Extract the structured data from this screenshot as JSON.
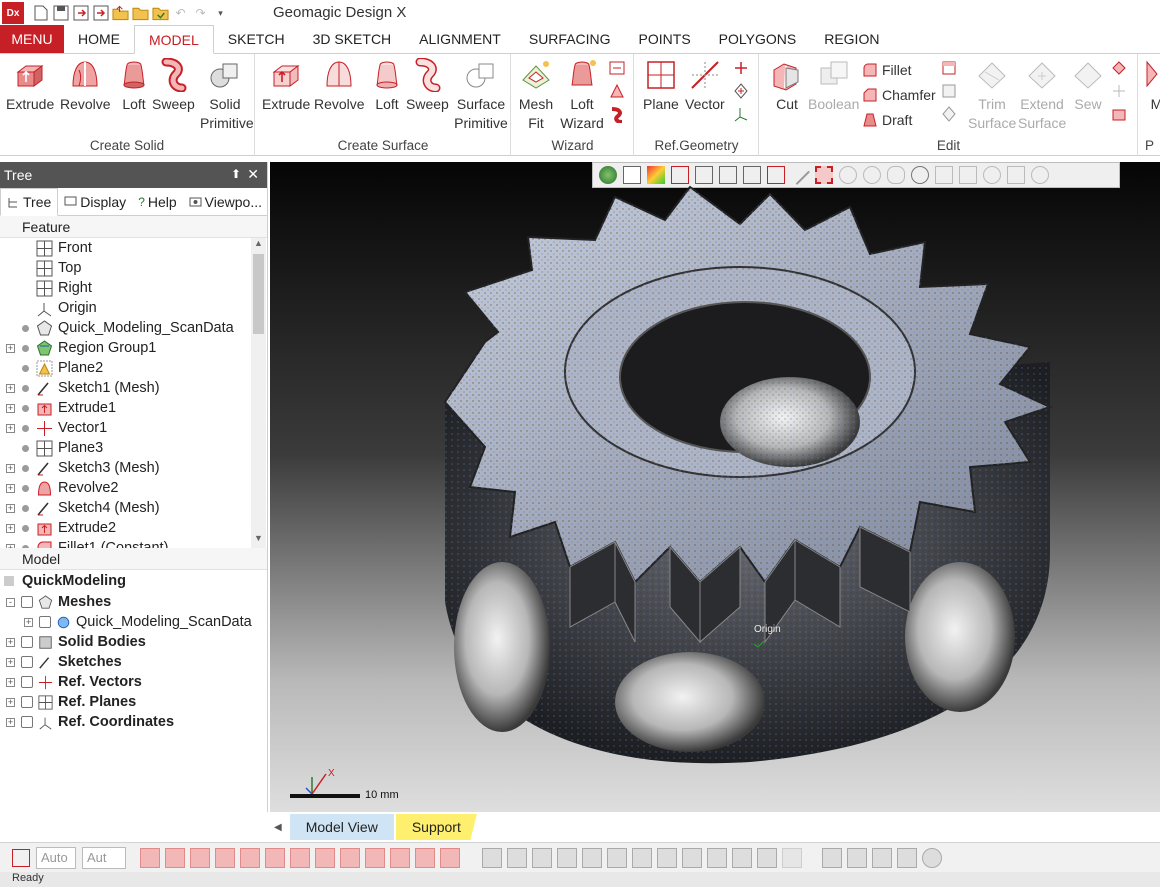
{
  "app": {
    "title": "Geomagic Design X",
    "logo": "Dx"
  },
  "menu_tabs": [
    "MENU",
    "HOME",
    "MODEL",
    "SKETCH",
    "3D SKETCH",
    "ALIGNMENT",
    "SURFACING",
    "POINTS",
    "POLYGONS",
    "REGION"
  ],
  "active_tab": "MODEL",
  "ribbon": {
    "create_solid": {
      "label": "Create Solid",
      "buttons": [
        "Extrude",
        "Revolve",
        "Loft",
        "Sweep",
        "Solid Primitive"
      ]
    },
    "create_surface": {
      "label": "Create Surface",
      "buttons": [
        "Extrude",
        "Revolve",
        "Loft",
        "Sweep",
        "Surface Primitive"
      ]
    },
    "wizard": {
      "label": "Wizard",
      "buttons": [
        "Mesh Fit",
        "Loft Wizard"
      ]
    },
    "ref_geometry": {
      "label": "Ref.Geometry",
      "buttons": [
        "Plane",
        "Vector"
      ]
    },
    "edit": {
      "label": "Edit",
      "buttons": [
        "Cut",
        "Boolean"
      ],
      "small": [
        "Fillet",
        "Chamfer",
        "Draft"
      ],
      "disabled": [
        "Trim Surface",
        "Extend Surface",
        "Sew"
      ]
    },
    "cut_off": {
      "label": "P",
      "button": "Mi"
    }
  },
  "panel": {
    "title": "Tree",
    "pin": "⬆",
    "close": "✕",
    "subtabs": [
      "Tree",
      "Display",
      "Help",
      "Viewpo..."
    ],
    "feature_header": "Feature",
    "features": [
      {
        "label": "Front",
        "icon": "plane-icon",
        "expand": false,
        "dot": false
      },
      {
        "label": "Top",
        "icon": "plane-icon",
        "expand": false,
        "dot": false
      },
      {
        "label": "Right",
        "icon": "plane-icon",
        "expand": false,
        "dot": false
      },
      {
        "label": "Origin",
        "icon": "origin-icon",
        "expand": false,
        "dot": false
      },
      {
        "label": "Quick_Modeling_ScanData",
        "icon": "mesh-icon",
        "expand": false,
        "dot": true
      },
      {
        "label": "Region Group1",
        "icon": "region-group-icon",
        "expand": true,
        "dot": true
      },
      {
        "label": "Plane2",
        "icon": "warning-plane-icon",
        "expand": false,
        "dot": true
      },
      {
        "label": "Sketch1 (Mesh)",
        "icon": "sketch-icon",
        "expand": true,
        "dot": true
      },
      {
        "label": "Extrude1",
        "icon": "extrude-icon",
        "expand": true,
        "dot": true
      },
      {
        "label": "Vector1",
        "icon": "vector-icon",
        "expand": true,
        "dot": true
      },
      {
        "label": "Plane3",
        "icon": "plane-icon",
        "expand": false,
        "dot": true
      },
      {
        "label": "Sketch3 (Mesh)",
        "icon": "sketch-icon",
        "expand": true,
        "dot": true
      },
      {
        "label": "Revolve2",
        "icon": "revolve-icon",
        "expand": true,
        "dot": true
      },
      {
        "label": "Sketch4 (Mesh)",
        "icon": "sketch-icon",
        "expand": true,
        "dot": true
      },
      {
        "label": "Extrude2",
        "icon": "extrude-icon",
        "expand": true,
        "dot": true
      },
      {
        "label": "Fillet1 (Constant)",
        "icon": "fillet-icon",
        "expand": true,
        "dot": true
      }
    ],
    "model_header": "Model",
    "model_root": "QuickModeling",
    "model_items": [
      {
        "label": "Meshes",
        "bold": true,
        "expand": "-",
        "indent": 0
      },
      {
        "label": "Quick_Modeling_ScanData",
        "bold": false,
        "expand": "+",
        "indent": 1
      },
      {
        "label": "Solid Bodies",
        "bold": true,
        "expand": "+",
        "indent": 0
      },
      {
        "label": "Sketches",
        "bold": true,
        "expand": "+",
        "indent": 0
      },
      {
        "label": "Ref. Vectors",
        "bold": true,
        "expand": "+",
        "indent": 0
      },
      {
        "label": "Ref. Planes",
        "bold": true,
        "expand": "+",
        "indent": 0
      },
      {
        "label": "Ref. Coordinates",
        "bold": true,
        "expand": "+",
        "indent": 0
      }
    ]
  },
  "viewport": {
    "origin_label": "Origin",
    "scale_label": "10 mm",
    "axis_x": "X"
  },
  "bottom_tabs": [
    "Model View",
    "Support"
  ],
  "bottom_toolbar": {
    "select1": "Auto",
    "select2": "Aut"
  },
  "status": "Ready"
}
